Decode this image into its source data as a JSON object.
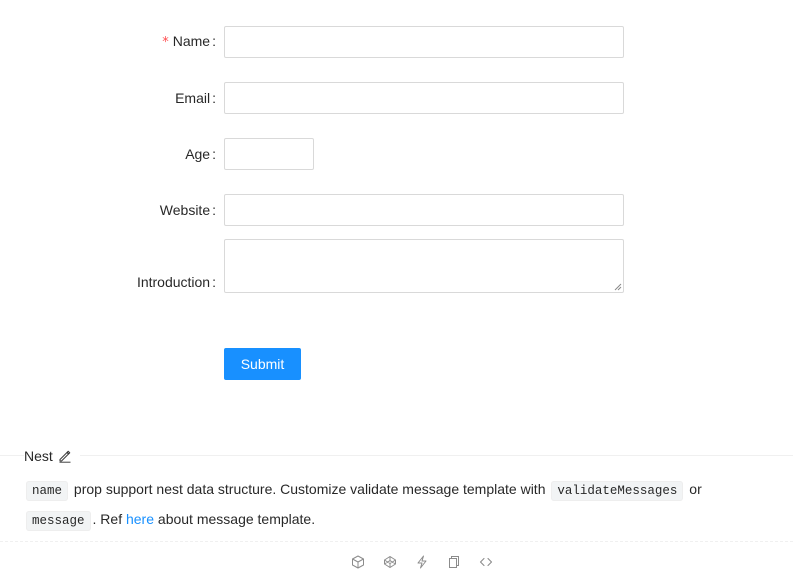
{
  "form": {
    "fields": [
      {
        "label": "Name",
        "required": true,
        "value": ""
      },
      {
        "label": "Email",
        "required": false,
        "value": ""
      },
      {
        "label": "Age",
        "required": false,
        "value": ""
      },
      {
        "label": "Website",
        "required": false,
        "value": ""
      },
      {
        "label": "Introduction",
        "required": false,
        "value": ""
      }
    ],
    "colon": ":",
    "required_mark": "*",
    "submit_label": "Submit"
  },
  "section": {
    "title": "Nest",
    "desc_code_name": "name",
    "desc_text_1": "prop support nest data structure. Customize validate message template with",
    "desc_code_validate": "validateMessages",
    "desc_text_2": "or",
    "desc_code_message": "message",
    "desc_text_3": ". Ref",
    "desc_link": "here",
    "desc_text_4": "about message template."
  },
  "actions": {
    "icons": [
      "codesandbox-icon",
      "codepen-icon",
      "thunderbolt-icon",
      "copy-icon",
      "expand-code-icon"
    ]
  },
  "colors": {
    "primary": "#1890ff",
    "required": "#ff4d4f",
    "border": "#d9d9d9"
  }
}
